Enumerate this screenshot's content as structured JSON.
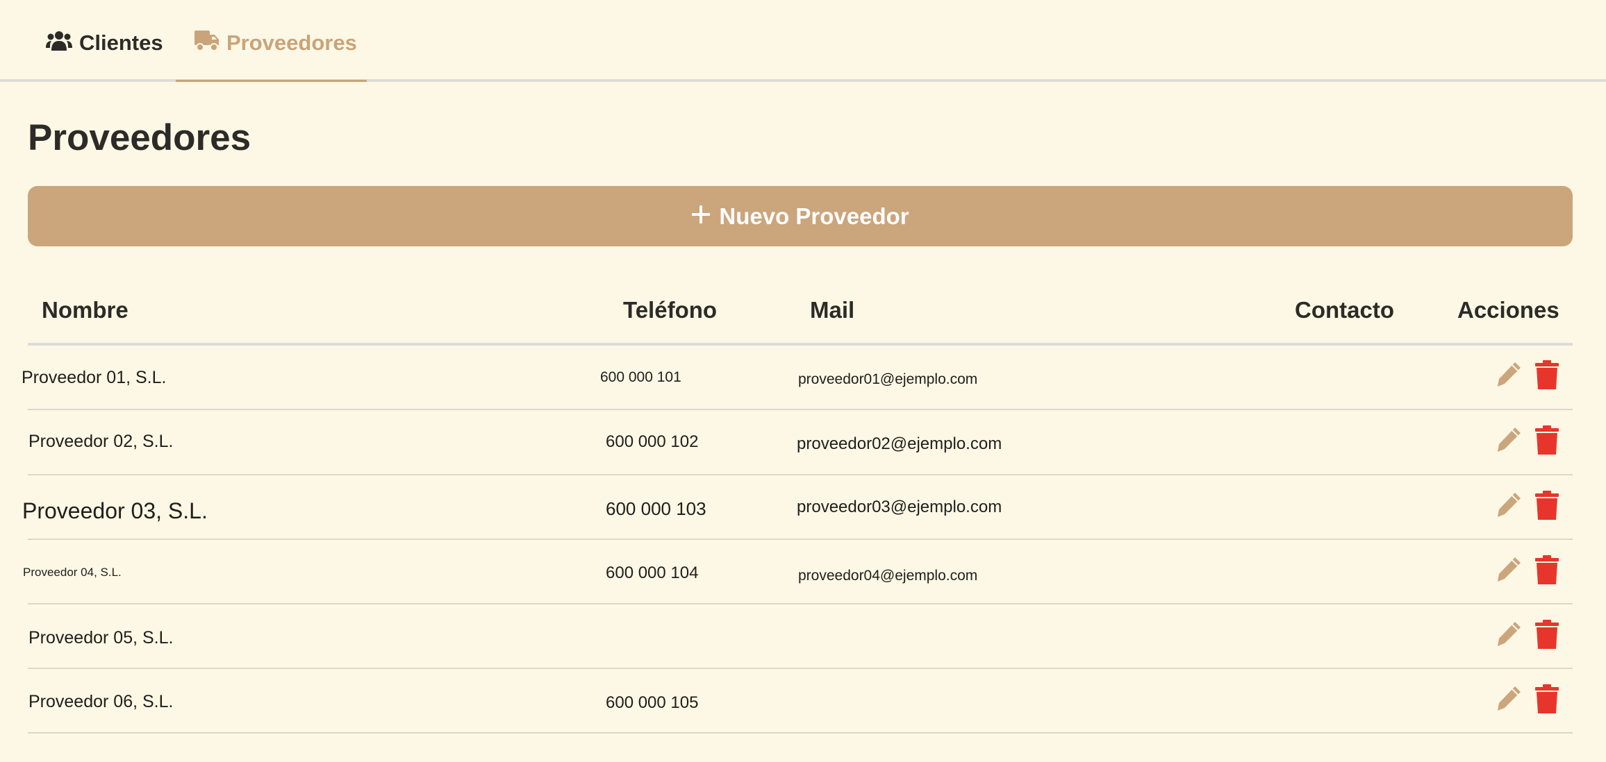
{
  "tabs": [
    {
      "label": "Clientes",
      "icon": "users-icon",
      "active": false
    },
    {
      "label": "Proveedores",
      "icon": "truck-icon",
      "active": true
    }
  ],
  "page": {
    "title": "Proveedores",
    "new_button_label": "Nuevo Proveedor"
  },
  "table": {
    "headers": {
      "name": "Nombre",
      "phone": "Teléfono",
      "mail": "Mail",
      "contact": "Contacto",
      "actions": "Acciones"
    },
    "rows": [
      {
        "name": "Proveedor 01, S.L.",
        "phone": "600 000 101",
        "mail": "proveedor01@ejemplo.com",
        "contact": ""
      },
      {
        "name": "Proveedor 02, S.L.",
        "phone": "600 000 102",
        "mail": "proveedor02@ejemplo.com",
        "contact": ""
      },
      {
        "name": "Proveedor 03, S.L.",
        "phone": "600 000 103",
        "mail": "proveedor03@ejemplo.com",
        "contact": ""
      },
      {
        "name": "Proveedor 04, S.L.",
        "phone": "600 000 104",
        "mail": "proveedor04@ejemplo.com",
        "contact": ""
      },
      {
        "name": "Proveedor 05, S.L.",
        "phone": "",
        "mail": "",
        "contact": ""
      },
      {
        "name": "Proveedor 06, S.L.",
        "phone": "600 000 105",
        "mail": "",
        "contact": ""
      }
    ]
  },
  "colors": {
    "background": "#fcf8e5",
    "accent": "#cba57c",
    "delete": "#e8352b",
    "text": "#2c2b27"
  }
}
